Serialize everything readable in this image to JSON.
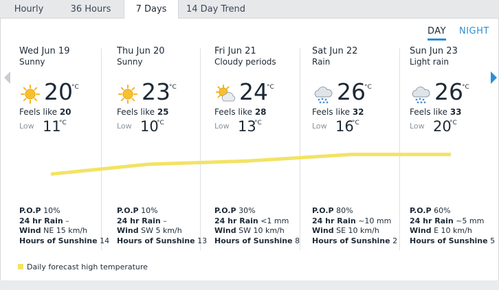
{
  "tabs": [
    {
      "label": "Hourly",
      "active": false
    },
    {
      "label": "36 Hours",
      "active": false
    },
    {
      "label": "7 Days",
      "active": true
    },
    {
      "label": "14 Day Trend",
      "active": false
    }
  ],
  "toggle": {
    "day_label": "DAY",
    "night_label": "NIGHT",
    "selected": "DAY"
  },
  "days": [
    {
      "date": "Wed Jun 19",
      "condition": "Sunny",
      "icon": "sun-icon",
      "high": "20",
      "high_unit": "°C",
      "feels_label": "Feels like",
      "feels": "20",
      "low_label": "Low",
      "low": "11",
      "low_unit": "°C",
      "pop_label": "P.O.P",
      "pop": "10%",
      "rain_label": "24 hr Rain",
      "rain": "–",
      "wind_label": "Wind",
      "wind": "NE 15 km/h",
      "sun_label": "Hours of Sunshine",
      "sunshine": "14"
    },
    {
      "date": "Thu Jun 20",
      "condition": "Sunny",
      "icon": "sun-icon",
      "high": "23",
      "high_unit": "°C",
      "feels_label": "Feels like",
      "feels": "25",
      "low_label": "Low",
      "low": "10",
      "low_unit": "°C",
      "pop_label": "P.O.P",
      "pop": "10%",
      "rain_label": "24 hr Rain",
      "rain": "–",
      "wind_label": "Wind",
      "wind": "SW 5 km/h",
      "sun_label": "Hours of Sunshine",
      "sunshine": "13"
    },
    {
      "date": "Fri Jun 21",
      "condition": "Cloudy periods",
      "icon": "sun-cloud-icon",
      "high": "24",
      "high_unit": "°C",
      "feels_label": "Feels like",
      "feels": "28",
      "low_label": "Low",
      "low": "13",
      "low_unit": "°C",
      "pop_label": "P.O.P",
      "pop": "30%",
      "rain_label": "24 hr Rain",
      "rain": "<1 mm",
      "wind_label": "Wind",
      "wind": "SW 10 km/h",
      "sun_label": "Hours of Sunshine",
      "sunshine": "8"
    },
    {
      "date": "Sat Jun 22",
      "condition": "Rain",
      "icon": "rain-cloud-icon",
      "high": "26",
      "high_unit": "°C",
      "feels_label": "Feels like",
      "feels": "32",
      "low_label": "Low",
      "low": "16",
      "low_unit": "°C",
      "pop_label": "P.O.P",
      "pop": "80%",
      "rain_label": "24 hr Rain",
      "rain": "~10 mm",
      "wind_label": "Wind",
      "wind": "SE 10 km/h",
      "sun_label": "Hours of Sunshine",
      "sunshine": "2"
    },
    {
      "date": "Sun Jun 23",
      "condition": "Light rain",
      "icon": "rain-cloud-icon",
      "high": "26",
      "high_unit": "°C",
      "feels_label": "Feels like",
      "feels": "33",
      "low_label": "Low",
      "low": "20",
      "low_unit": "°C",
      "pop_label": "P.O.P",
      "pop": "60%",
      "rain_label": "24 hr Rain",
      "rain": "~5 mm",
      "wind_label": "Wind",
      "wind": "E 10 km/h",
      "sun_label": "Hours of Sunshine",
      "sunshine": "5"
    }
  ],
  "legend": {
    "label": "Daily forecast high temperature",
    "color": "#f3e365"
  },
  "colors": {
    "accent": "#2b8fd6",
    "trend_line": "#f3e365",
    "sun": "#f5b51e"
  }
}
